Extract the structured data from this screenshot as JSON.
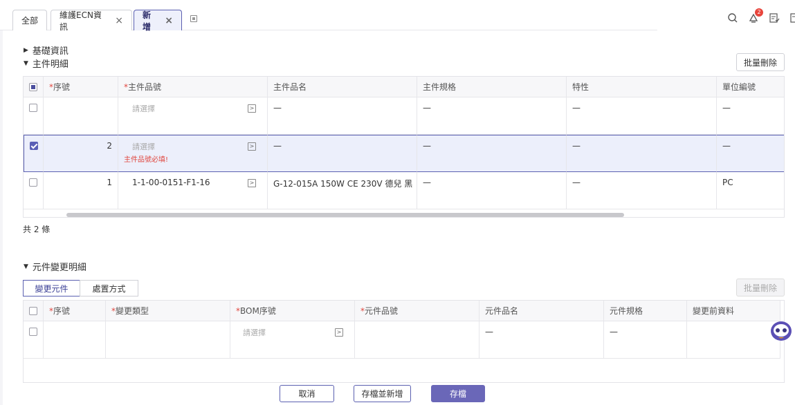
{
  "tabs": [
    {
      "label": "全部",
      "closable": false
    },
    {
      "label": "維護ECN資訊",
      "closable": true
    },
    {
      "label": "新增",
      "closable": true,
      "active": true
    }
  ],
  "tab_close_glyph": "×",
  "top_icons": [
    "search-icon",
    "notification-icon",
    "checklist-icon",
    "document-icon"
  ],
  "notification_count": "2",
  "sections": {
    "basic_info": "基礎資訊",
    "main_detail": "主件明細",
    "component_change": "元件變更明細"
  },
  "main_table": {
    "batch_delete_label": "批量刪除",
    "columns": [
      "序號",
      "主件品號",
      "主件品名",
      "主件規格",
      "特性",
      "單位編號"
    ],
    "required_columns": [
      "序號",
      "主件品號"
    ],
    "rows": [
      {
        "seq": "",
        "part_no": "",
        "part_no_placeholder": "請選擇",
        "part_name": "—",
        "spec": "—",
        "feature": "—",
        "unit": "—",
        "checked": false,
        "error": ""
      },
      {
        "seq": "2",
        "part_no": "",
        "part_no_placeholder": "請選擇",
        "part_name": "—",
        "spec": "—",
        "feature": "—",
        "unit": "—",
        "checked": true,
        "error": "主件品號必填!"
      },
      {
        "seq": "1",
        "part_no": "1-1-00-0151-F1-16",
        "part_no_placeholder": "",
        "part_name": "G-12-015A 150W CE 230V 德兒 黑",
        "spec": "—",
        "feature": "—",
        "unit": "PC",
        "checked": false,
        "error": ""
      }
    ],
    "total_label": "共 2 條"
  },
  "component_table": {
    "segment_tabs": [
      "變更元件",
      "處置方式"
    ],
    "active_segment": "變更元件",
    "batch_delete_label": "批量刪除",
    "columns": [
      "序號",
      "變更類型",
      "BOM序號",
      "元件品號",
      "元件品名",
      "元件規格",
      "變更前資料"
    ],
    "required_columns": [
      "序號",
      "變更類型",
      "BOM序號",
      "元件品號"
    ],
    "rows": [
      {
        "seq": "",
        "change_type": "",
        "bom_seq_placeholder": "請選擇",
        "part_no": "",
        "part_name": "—",
        "spec": "—",
        "before": ""
      }
    ]
  },
  "actions": {
    "cancel": "取消",
    "save_and_new": "存檔並新增",
    "save": "存檔"
  },
  "colors": {
    "accent": "#6a67b8",
    "error": "#e0473f",
    "selected_row": "#eceffb"
  }
}
